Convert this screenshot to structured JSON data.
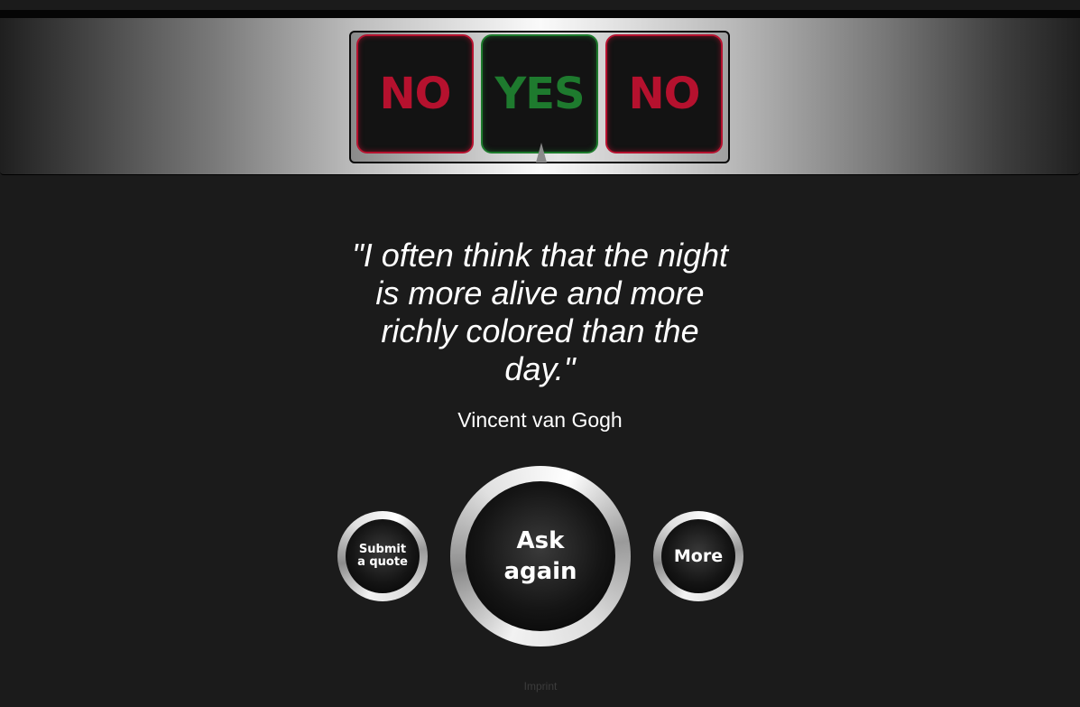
{
  "slot": {
    "reels": [
      {
        "label": "NO",
        "color": "#b5112e"
      },
      {
        "label": "YES",
        "color": "#1e7a2e"
      },
      {
        "label": "NO",
        "color": "#b5112e"
      }
    ]
  },
  "quote": {
    "text": "\"I often think that the night is more alive and more richly colored than the day.\"",
    "author": "Vincent van Gogh"
  },
  "buttons": {
    "submit_label": "Submit a quote",
    "ask_label": "Ask again",
    "more_label": "More"
  },
  "footer": {
    "imprint_label": "Imprint"
  },
  "colors": {
    "background": "#1b1b1b",
    "no": "#b5112e",
    "yes": "#1e7a2e"
  }
}
